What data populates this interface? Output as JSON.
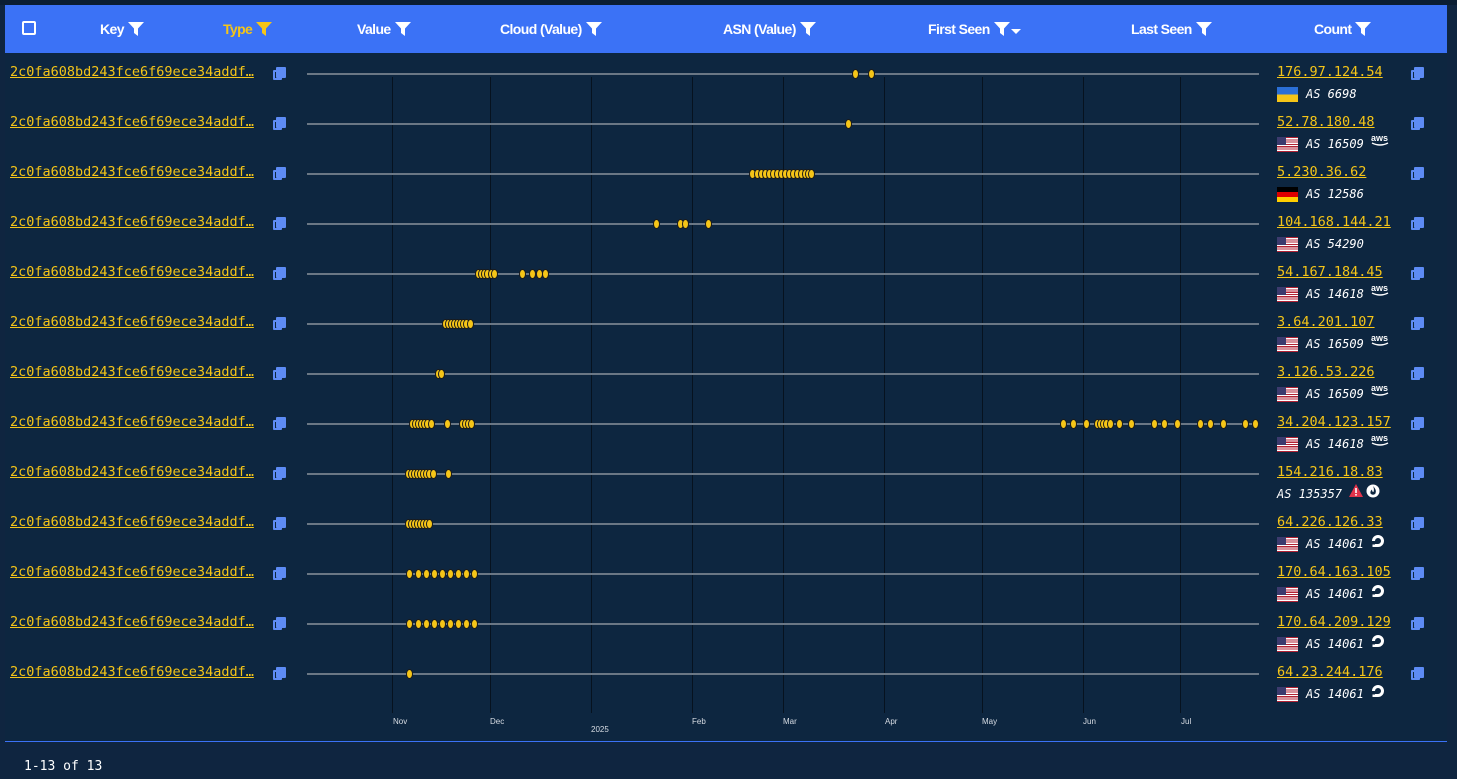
{
  "header": {
    "columns": [
      {
        "label": "Key"
      },
      {
        "label": "Type"
      },
      {
        "label": "Value"
      },
      {
        "label": "Cloud (Value)"
      },
      {
        "label": "ASN (Value)"
      },
      {
        "label": "First Seen"
      },
      {
        "label": "Last Seen"
      },
      {
        "label": "Count"
      }
    ]
  },
  "axis": {
    "months": [
      "Nov",
      "Dec",
      "Feb",
      "Mar",
      "Apr",
      "May",
      "Jun",
      "Jul"
    ],
    "year": "2025"
  },
  "rows": [
    {
      "key": "2c0fa608bd243fce6f69ece34addf",
      "ip": "176.97.124.54",
      "asn": "AS 6698",
      "flag": "UA",
      "cloud": ""
    },
    {
      "key": "2c0fa608bd243fce6f69ece34addf",
      "ip": "52.78.180.48",
      "asn": "AS 16509",
      "flag": "US",
      "cloud": "aws"
    },
    {
      "key": "2c0fa608bd243fce6f69ece34addf",
      "ip": "5.230.36.62",
      "asn": "AS 12586",
      "flag": "DE",
      "cloud": ""
    },
    {
      "key": "2c0fa608bd243fce6f69ece34addf",
      "ip": "104.168.144.21",
      "asn": "AS 54290",
      "flag": "US",
      "cloud": ""
    },
    {
      "key": "2c0fa608bd243fce6f69ece34addf",
      "ip": "54.167.184.45",
      "asn": "AS 14618",
      "flag": "US",
      "cloud": "aws"
    },
    {
      "key": "2c0fa608bd243fce6f69ece34addf",
      "ip": "3.64.201.107",
      "asn": "AS 16509",
      "flag": "US",
      "cloud": "aws"
    },
    {
      "key": "2c0fa608bd243fce6f69ece34addf",
      "ip": "3.126.53.226",
      "asn": "AS 16509",
      "flag": "US",
      "cloud": "aws"
    },
    {
      "key": "2c0fa608bd243fce6f69ece34addf",
      "ip": "34.204.123.157",
      "asn": "AS 14618",
      "flag": "US",
      "cloud": "aws"
    },
    {
      "key": "2c0fa608bd243fce6f69ece34addf",
      "ip": "154.216.18.83",
      "asn": "AS 135357",
      "flag": "",
      "cloud": "warning-fire"
    },
    {
      "key": "2c0fa608bd243fce6f69ece34addf",
      "ip": "64.226.126.33",
      "asn": "AS 14061",
      "flag": "US",
      "cloud": "digitalocean"
    },
    {
      "key": "2c0fa608bd243fce6f69ece34addf",
      "ip": "170.64.163.105",
      "asn": "AS 14061",
      "flag": "US",
      "cloud": "digitalocean"
    },
    {
      "key": "2c0fa608bd243fce6f69ece34addf",
      "ip": "170.64.209.129",
      "asn": "AS 14061",
      "flag": "US",
      "cloud": "digitalocean"
    },
    {
      "key": "2c0fa608bd243fce6f69ece34addf",
      "ip": "64.23.244.176",
      "asn": "AS 14061",
      "flag": "US",
      "cloud": "digitalocean"
    }
  ],
  "colors": {
    "header_bg": "#3b72f6",
    "accent": "#f5c518",
    "bg": "#0d2640"
  },
  "footer": {
    "pagination": "1-13 of 13"
  }
}
